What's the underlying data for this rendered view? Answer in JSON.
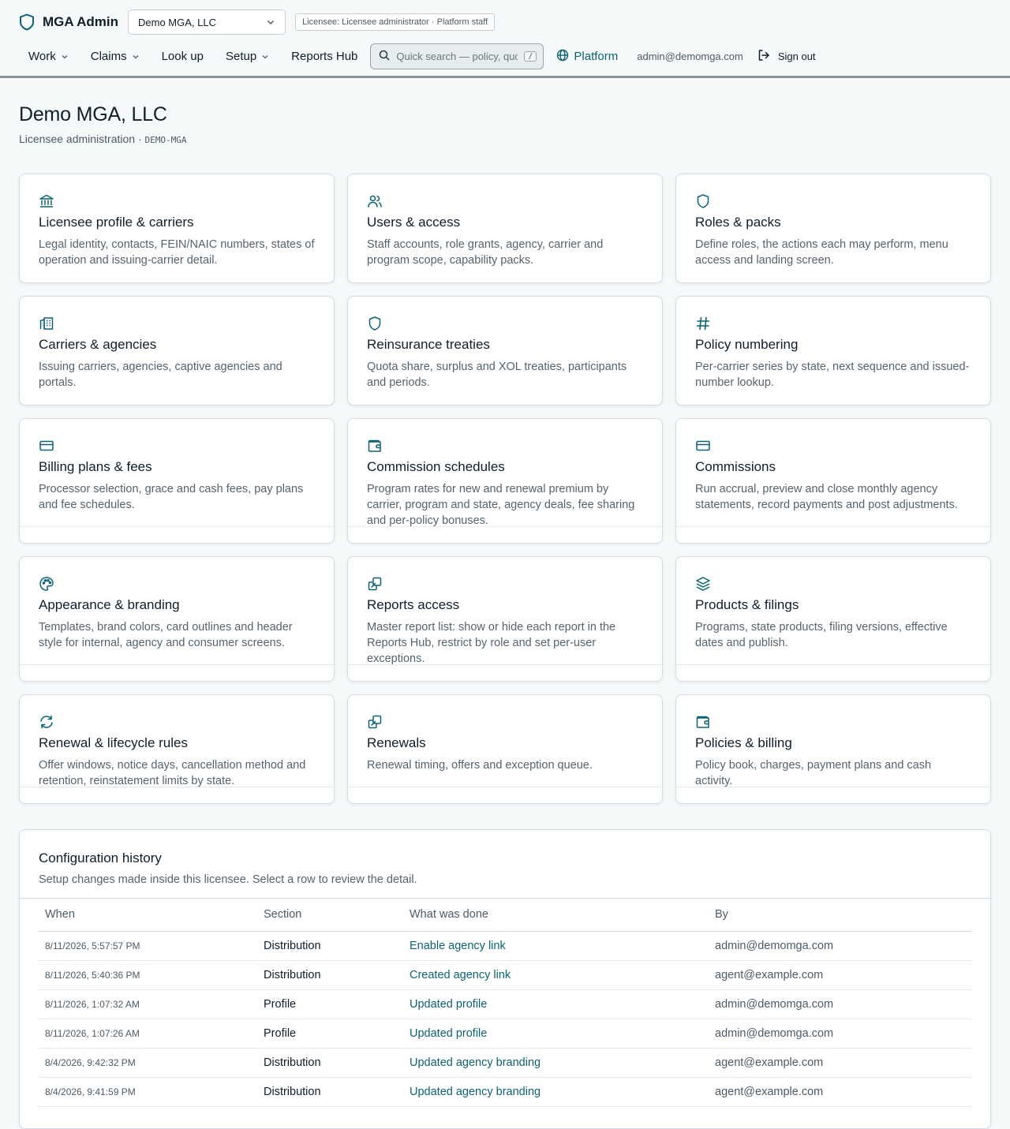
{
  "header": {
    "app_name": "MGA Admin",
    "org_selected": "Demo MGA, LLC",
    "licensee_badge": "Licensee: Licensee administrator · Platform staff",
    "nav": [
      {
        "label": "Work",
        "has_caret": true
      },
      {
        "label": "Claims",
        "has_caret": true
      },
      {
        "label": "Look up",
        "has_caret": false
      },
      {
        "label": "Setup",
        "has_caret": true
      },
      {
        "label": "Reports Hub",
        "has_caret": false
      }
    ],
    "search_placeholder": "Quick search — policy, quote",
    "search_shortcut": "/",
    "platform_label": "Platform",
    "user_email": "admin@demomga.com",
    "sign_out_label": "Sign out"
  },
  "page": {
    "title": "Demo MGA, LLC",
    "subtitle": "Licensee administration · ",
    "code": "DEMO-MGA"
  },
  "cards": [
    {
      "icon": "bank-icon",
      "title": "Licensee profile & carriers",
      "desc": "Legal identity, contacts, FEIN/NAIC numbers, states of operation and issuing-carrier detail."
    },
    {
      "icon": "users-icon",
      "title": "Users & access",
      "desc": "Staff accounts, role grants, agency, carrier and program scope, capability packs."
    },
    {
      "icon": "shield-icon",
      "title": "Roles & packs",
      "desc": "Define roles, the actions each may perform, menu access and landing screen."
    },
    {
      "icon": "building-icon",
      "title": "Carriers & agencies",
      "desc": "Issuing carriers, agencies, captive agencies and portals."
    },
    {
      "icon": "shield-icon",
      "title": "Reinsurance treaties",
      "desc": "Quota share, surplus and XOL treaties, participants and periods."
    },
    {
      "icon": "hash-icon",
      "title": "Policy numbering",
      "desc": "Per-carrier series by state, next sequence and issued-number lookup."
    },
    {
      "icon": "credit-card-icon",
      "title": "Billing plans & fees",
      "desc": "Processor selection, grace and cash fees, pay plans and fee schedules."
    },
    {
      "icon": "wallet-icon",
      "title": "Commission schedules",
      "desc": "Program rates for new and renewal premium by carrier, program and state, agency deals, fee sharing and per-policy bonuses."
    },
    {
      "icon": "credit-card-icon",
      "title": "Commissions",
      "desc": "Run accrual, preview and close monthly agency statements, record payments and post adjustments."
    },
    {
      "icon": "palette-icon",
      "title": "Appearance & branding",
      "desc": "Templates, brand colors, card outlines and header style for internal, agency and consumer screens."
    },
    {
      "icon": "copy-icon",
      "title": "Reports access",
      "desc": "Master report list: show or hide each report in the Reports Hub, restrict by role and set per-user exceptions."
    },
    {
      "icon": "layers-icon",
      "title": "Products & filings",
      "desc": "Programs, state products, filing versions, effective dates and publish."
    },
    {
      "icon": "refresh-icon",
      "title": "Renewal & lifecycle rules",
      "desc": "Offer windows, notice days, cancellation method and retention, reinstatement limits by state."
    },
    {
      "icon": "copy-icon",
      "title": "Renewals",
      "desc": "Renewal timing, offers and exception queue."
    },
    {
      "icon": "wallet-icon",
      "title": "Policies & billing",
      "desc": "Policy book, charges, payment plans and cash activity."
    }
  ],
  "history": {
    "title": "Configuration history",
    "subtitle": "Setup changes made inside this licensee. Select a row to review the detail.",
    "columns": [
      "When",
      "Section",
      "What was done",
      "By"
    ],
    "rows": [
      {
        "when": "8/11/2026, 5:57:57 PM",
        "section": "Distribution",
        "action": "Enable agency link",
        "by": "admin@demomga.com"
      },
      {
        "when": "8/11/2026, 5:40:36 PM",
        "section": "Distribution",
        "action": "Created agency link",
        "by": "agent@example.com"
      },
      {
        "when": "8/11/2026, 1:07:32 AM",
        "section": "Profile",
        "action": "Updated profile",
        "by": "admin@demomga.com"
      },
      {
        "when": "8/11/2026, 1:07:26 AM",
        "section": "Profile",
        "action": "Updated profile",
        "by": "admin@demomga.com"
      },
      {
        "when": "8/4/2026, 9:42:32 PM",
        "section": "Distribution",
        "action": "Updated agency branding",
        "by": "agent@example.com"
      },
      {
        "when": "8/4/2026, 9:41:59 PM",
        "section": "Distribution",
        "action": "Updated agency branding",
        "by": "agent@example.com"
      }
    ]
  },
  "colors": {
    "accent": "#0d6273",
    "background": "#f5f9fa",
    "text": "#0f1e2a",
    "muted": "#55636e"
  }
}
